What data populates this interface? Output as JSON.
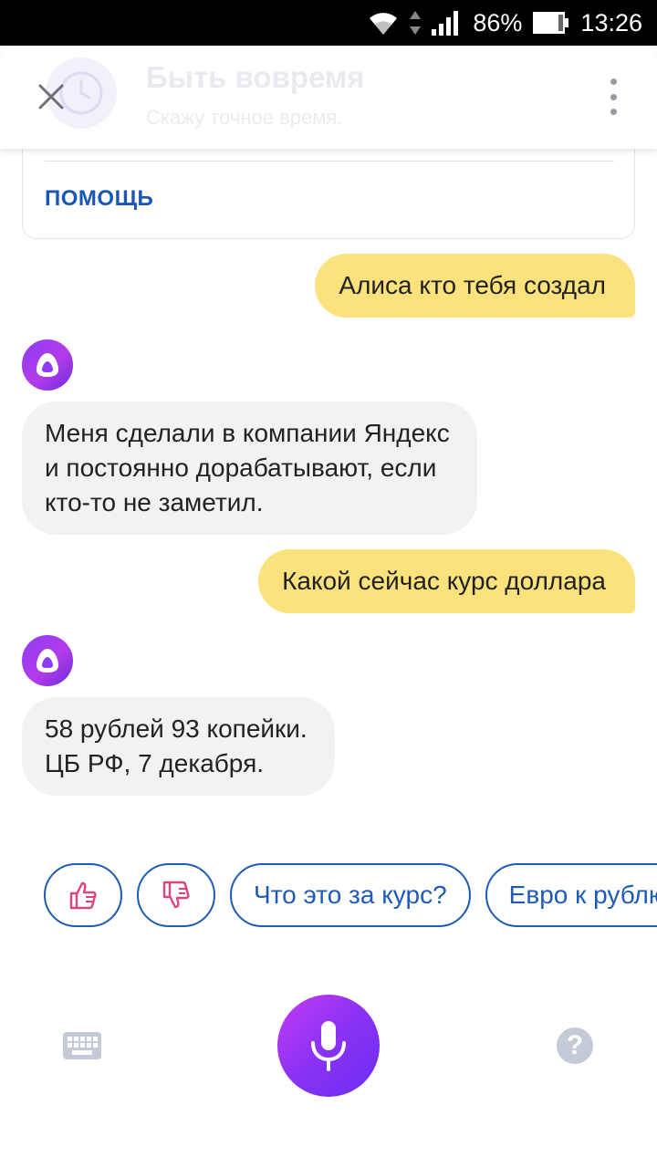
{
  "status_bar": {
    "battery": "86%",
    "time": "13:26",
    "icons": [
      "wifi-icon",
      "data-arrows-icon",
      "cellular-signal-icon",
      "battery-icon"
    ]
  },
  "header": {
    "title": "Быть вовремя",
    "subtitle": "Скажу точное время.",
    "icons": [
      "close-icon",
      "clock-icon",
      "more-vertical-icon"
    ]
  },
  "help_card": {
    "link": "ПОМОЩЬ"
  },
  "messages": [
    {
      "from": "user",
      "lines": [
        "Алиса кто тебя создал"
      ]
    },
    {
      "from": "bot",
      "lines": [
        "Меня сделали в компании Яндекс",
        "и постоянно дорабатывают, если",
        "кто-то не заметил."
      ]
    },
    {
      "from": "user",
      "lines": [
        "Какой сейчас курс доллара"
      ]
    },
    {
      "from": "bot",
      "lines": [
        "58 рублей 93 копейки.",
        "ЦБ РФ, 7 декабря."
      ]
    }
  ],
  "suggestions": {
    "icons": [
      "thumbs-up-icon",
      "thumbs-down-icon"
    ],
    "chips": [
      "Что это за курс?",
      "Евро к рублю"
    ]
  },
  "bottom_bar": {
    "icons": [
      "keyboard-icon",
      "microphone-icon",
      "question-icon"
    ],
    "help_glyph": "?"
  },
  "colors": {
    "user_bubble": "#fbe27d",
    "bot_bubble": "#f2f2f4",
    "accent_blue": "#1e5bb7",
    "alice_purple": "#8b3df7"
  }
}
